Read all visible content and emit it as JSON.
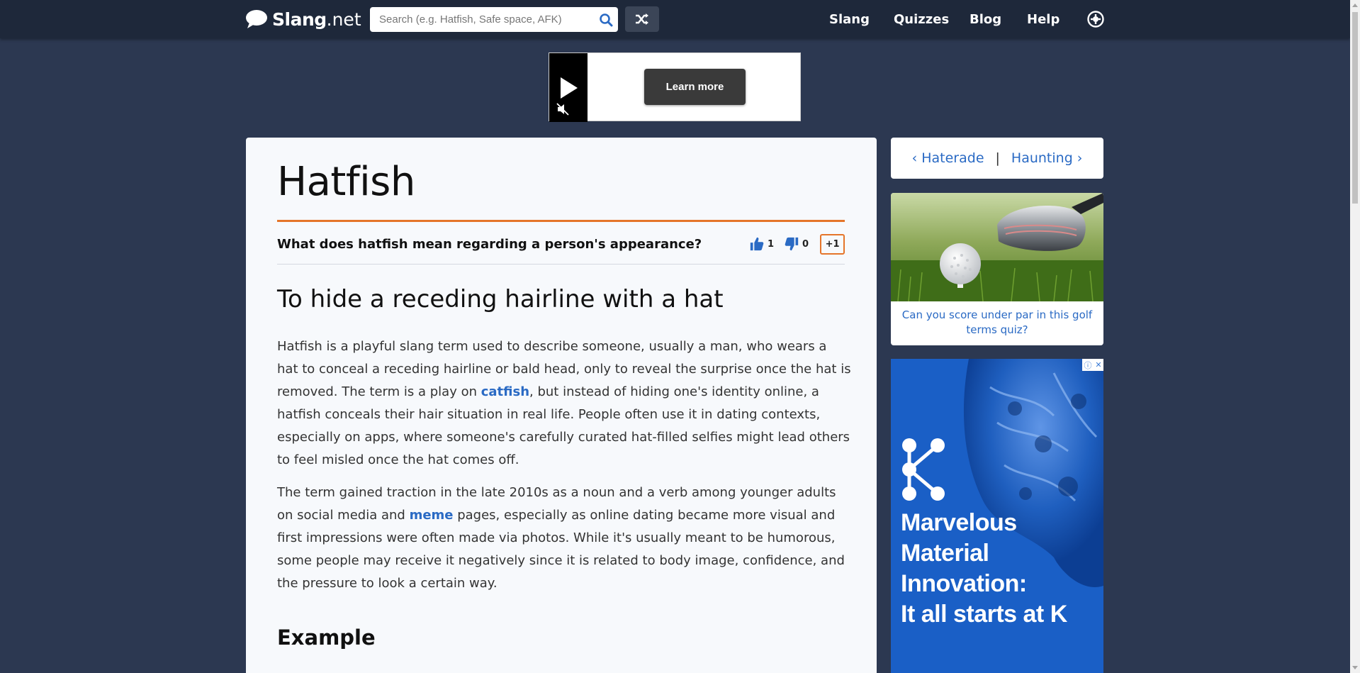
{
  "header": {
    "logo_main": "Slang",
    "logo_tld": ".net",
    "search_placeholder": "Search (e.g. Hatfish, Safe space, AFK)",
    "nav": [
      "Slang",
      "Quizzes",
      "Blog",
      "Help"
    ],
    "icons": [
      "chat-bubble-icon",
      "search-icon",
      "shuffle-icon",
      "gear-icon"
    ]
  },
  "top_ad": {
    "button_label": "Learn more",
    "icons": [
      "play-icon",
      "mute-icon"
    ]
  },
  "article": {
    "title": "Hatfish",
    "question": "What does hatfish mean regarding a person's appearance?",
    "upvotes": "1",
    "downvotes": "0",
    "plus_one": "+1",
    "subtitle": "To hide a receding hairline with a hat",
    "para1_a": "Hatfish is a playful slang term used to describe someone, usually a man, who wears a hat to conceal a receding hairline or bald head, only to reveal the surprise once the hat is removed. The term is a play on ",
    "para1_link": "catfish",
    "para1_b": ", but instead of hiding one's identity online, a hatfish conceals their hair situation in real life. People often use it in dating contexts, especially on apps, where someone's carefully curated hat-filled selfies might lead others to feel misled once the hat comes off.",
    "para2_a": "The term gained traction in the late 2010s as a noun and a verb among younger adults on social media and ",
    "para2_link": "meme",
    "para2_b": " pages, especially as online dating became more visual and first impressions were often made via photos. While it's usually meant to be humorous, some people may receive it negatively since it is related to body image, confidence, and the pressure to look a certain way.",
    "example_heading": "Example"
  },
  "sidebar": {
    "prev": "‹ Haterade",
    "separator": "|",
    "next": "Haunting ›",
    "quiz_text": "Can you score under par in this golf terms quiz?",
    "ad_text_lines": [
      "Marvelous",
      "Material",
      "Innovation:",
      "It all starts at K"
    ]
  },
  "colors": {
    "background": "#2c3851",
    "header": "#1e283a",
    "accent_orange": "#e5752a",
    "link_blue": "#2a6ac4",
    "ad_blue": "#1a5fc6"
  }
}
